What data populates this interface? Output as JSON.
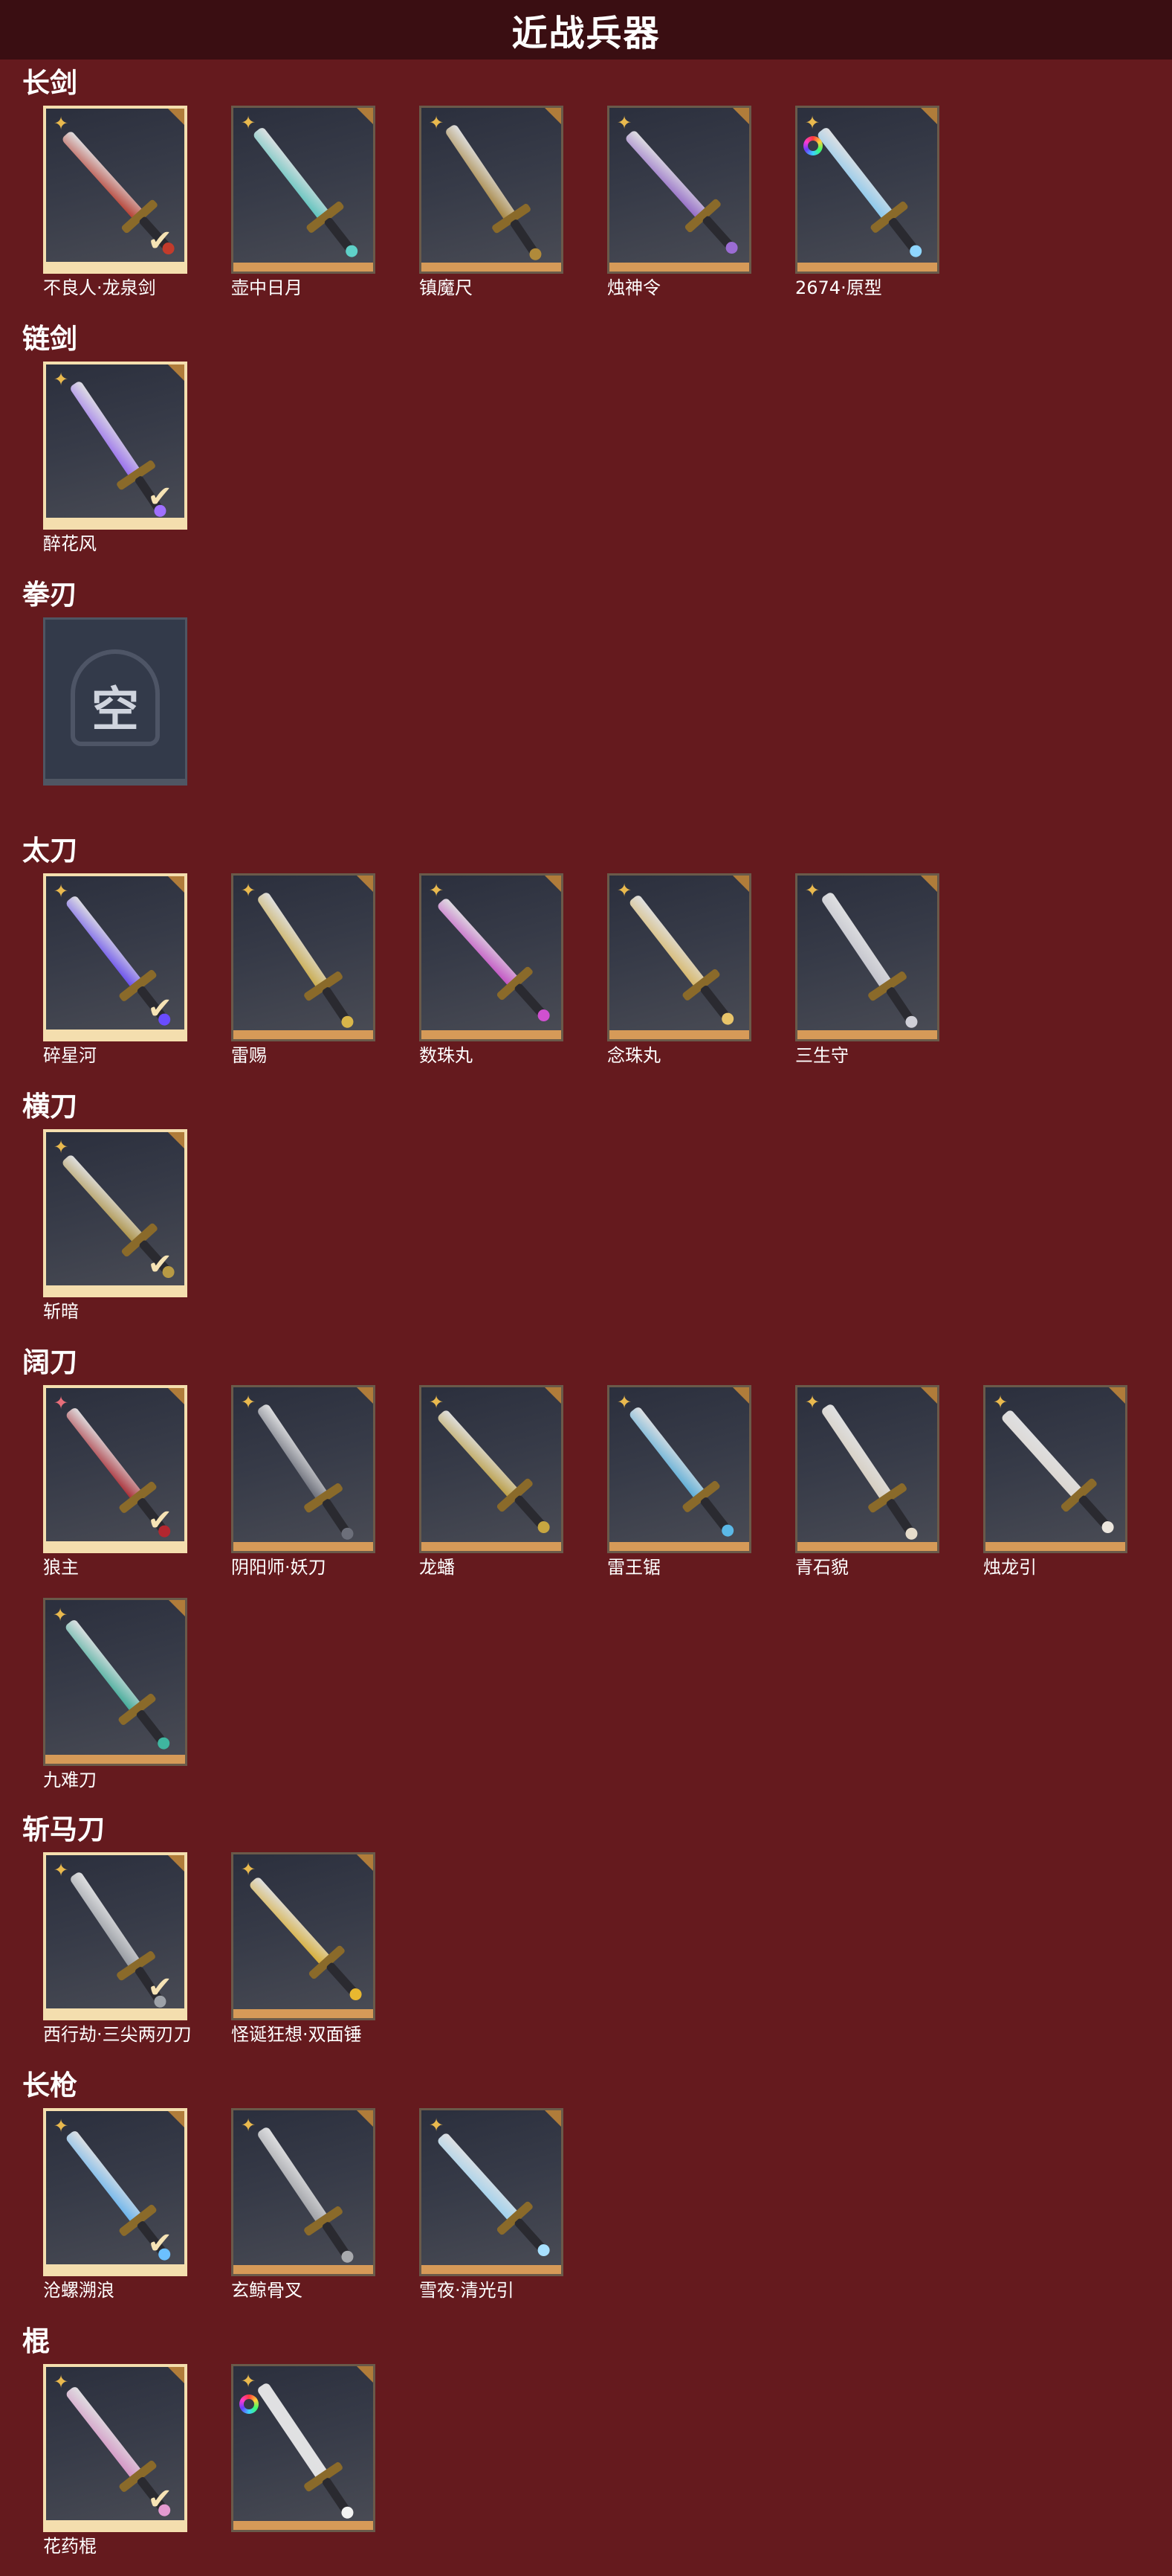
{
  "header": {
    "title": "近战兵器"
  },
  "icons": {
    "rank": "sparkle-star-icon",
    "equipped": "checkmark-icon",
    "rainbow": "rainbow-ring-icon",
    "empty": "empty-slot-icon"
  },
  "sections": [
    {
      "title": "长剑",
      "items": [
        {
          "name": "不良人·龙泉剑",
          "equipped": true,
          "rank": "gold",
          "color": "#c23b2b"
        },
        {
          "name": "壶中日月",
          "equipped": false,
          "rank": "gold",
          "color": "#5fd1c9"
        },
        {
          "name": "镇魔尺",
          "equipped": false,
          "rank": "gold",
          "color": "#b08a3a"
        },
        {
          "name": "烛神令",
          "equipped": false,
          "rank": "gold",
          "color": "#9b6cd4"
        },
        {
          "name": "2674·原型",
          "equipped": false,
          "rank": "gold",
          "rainbow": true,
          "color": "#8fd6ff"
        }
      ]
    },
    {
      "title": "链剑",
      "items": [
        {
          "name": "醉花风",
          "equipped": true,
          "rank": "gold",
          "color": "#a070ff"
        }
      ]
    },
    {
      "title": "拳刃",
      "items": [
        {
          "name": "",
          "empty": true,
          "empty_label": "空"
        }
      ]
    },
    {
      "title": "太刀",
      "items": [
        {
          "name": "碎星河",
          "equipped": true,
          "rank": "gold",
          "color": "#6a4cff"
        },
        {
          "name": "雷赐",
          "equipped": false,
          "rank": "gold",
          "color": "#d9b64a"
        },
        {
          "name": "数珠丸",
          "equipped": false,
          "rank": "gold",
          "color": "#d050d0"
        },
        {
          "name": "念珠丸",
          "equipped": false,
          "rank": "gold",
          "color": "#e8c46a"
        },
        {
          "name": "三生守",
          "equipped": false,
          "rank": "gold",
          "color": "#d0d0d8"
        }
      ]
    },
    {
      "title": "横刀",
      "items": [
        {
          "name": "斩暗",
          "equipped": true,
          "rank": "gold",
          "color": "#b89a44"
        }
      ]
    },
    {
      "title": "阔刀",
      "items": [
        {
          "name": "狼主",
          "equipped": true,
          "rank": "pink",
          "color": "#b3272f"
        },
        {
          "name": "阴阳师·妖刀",
          "equipped": false,
          "rank": "gold",
          "color": "#6c6f7a"
        },
        {
          "name": "龙蟠",
          "equipped": false,
          "rank": "gold",
          "color": "#c7a640"
        },
        {
          "name": "雷王锯",
          "equipped": false,
          "rank": "gold",
          "color": "#5bb8e6"
        },
        {
          "name": "青石貌",
          "equipped": false,
          "rank": "gold",
          "color": "#e6dccb"
        },
        {
          "name": "烛龙引",
          "equipped": false,
          "rank": "gold",
          "color": "#ece6de"
        },
        {
          "name": "九难刀",
          "equipped": false,
          "rank": "gold",
          "color": "#3fb6a0"
        }
      ]
    },
    {
      "title": "斩马刀",
      "items": [
        {
          "name": "西行劫·三尖两刃刀",
          "equipped": true,
          "rank": "gold",
          "color": "#9ea2a8"
        },
        {
          "name": "怪诞狂想·双面锤",
          "equipped": false,
          "rank": "gold",
          "color": "#e8b82f"
        }
      ]
    },
    {
      "title": "长枪",
      "items": [
        {
          "name": "沧螺溯浪",
          "equipped": true,
          "rank": "gold",
          "color": "#6cc0ff"
        },
        {
          "name": "玄鲸骨叉",
          "equipped": false,
          "rank": "gold",
          "color": "#a8a9ad"
        },
        {
          "name": "雪夜·清光引",
          "equipped": false,
          "rank": "gold",
          "color": "#a8e0ff"
        }
      ]
    },
    {
      "title": "棍",
      "items": [
        {
          "name": "花药棍",
          "equipped": true,
          "rank": "gold",
          "color": "#e39ad0"
        },
        {
          "name": "",
          "equipped": false,
          "rank": "gold",
          "rainbow": true,
          "color": "#f2f2f2"
        }
      ]
    }
  ]
}
